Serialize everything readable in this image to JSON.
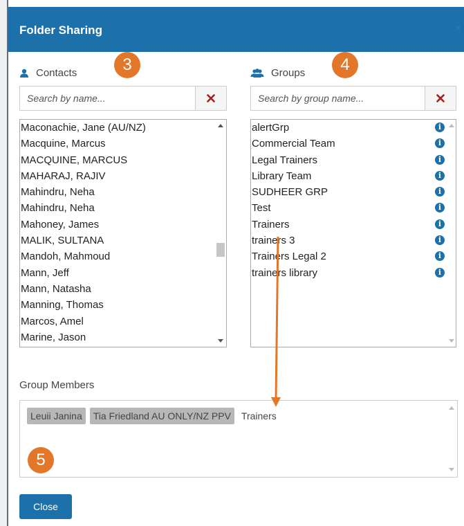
{
  "dialog": {
    "title": "Folder Sharing",
    "close_glyph": "×"
  },
  "contacts": {
    "label": "Contacts",
    "search_placeholder": "Search by name...",
    "items": [
      "Maconachie, Jane (AU/NZ)",
      "Macquine, Marcus",
      "MACQUINE, MARCUS",
      "MAHARAJ, RAJIV",
      "Mahindru, Neha",
      "Mahindru, Neha",
      "Mahoney, James",
      "MALIK, SULTANA",
      "Mandoh, Mahmoud",
      "Mann, Jeff",
      "Mann, Natasha",
      "Manning, Thomas",
      "Marcos, Amel",
      "Marine, Jason"
    ]
  },
  "groups": {
    "label": "Groups",
    "search_placeholder": "Search by group name...",
    "items": [
      "alertGrp",
      "Commercial Team",
      "Legal Trainers",
      "Library Team",
      "SUDHEER GRP",
      "Test",
      "Trainers",
      "trainers 3",
      "Trainers Legal 2",
      "trainers library"
    ]
  },
  "group_members": {
    "label": "Group Members",
    "tags": [
      "Leuii Janina",
      "Tia Friedland AU ONLY/NZ PPV"
    ],
    "selected_group": "Trainers"
  },
  "footer": {
    "close_label": "Close"
  },
  "annotations": {
    "badge_contacts": "3",
    "badge_groups": "4",
    "badge_members": "5"
  },
  "colors": {
    "header": "#1d71aa",
    "badge": "#e2772a",
    "arrow": "#e2772a",
    "clear_x": "#a02020"
  }
}
